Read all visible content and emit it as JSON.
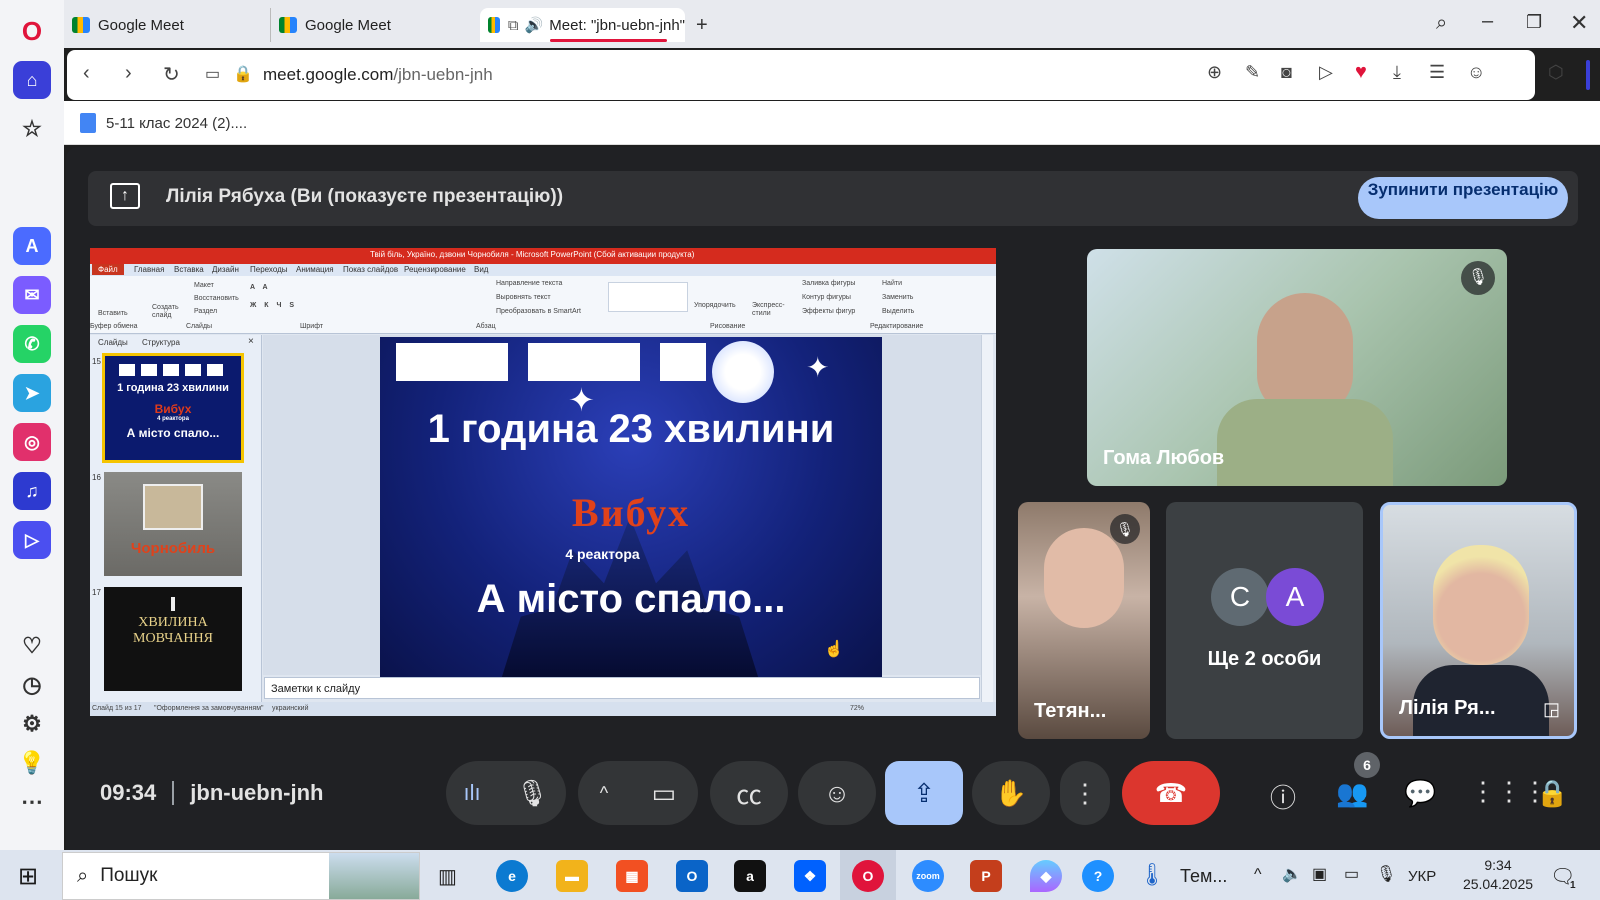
{
  "browser": {
    "tabs": [
      {
        "label": "Google Meet"
      },
      {
        "label": "Google Meet"
      },
      {
        "label": "Meet: \"jbn-uebn-jnh\""
      }
    ],
    "url_domain": "meet.google.com",
    "url_path": "/jbn-uebn-jnh",
    "bookmark": "5-11 клас 2024 (2)....",
    "accent": "#e0143b"
  },
  "meet": {
    "presenter_text": "Лілія Рябуха (Ви (показуєте презентацію))",
    "stop_button": "Зупинити презентацію",
    "time": "09:34",
    "meeting_code": "jbn-uebn-jnh",
    "participants_count": "6",
    "participants": [
      {
        "name": "Гома Любов",
        "muted": true
      },
      {
        "name": "Тетян...",
        "muted": true
      },
      {
        "initials": [
          "C",
          "A"
        ],
        "label": "Ще 2 особи"
      },
      {
        "name": "Лілія Ря..."
      }
    ]
  },
  "ppt": {
    "title": "Твій біль, Україно, дзвони Чорнобиля - Microsoft PowerPoint (Сбой активации продукта)",
    "ribbon_tabs": [
      "Файл",
      "Главная",
      "Вставка",
      "Дизайн",
      "Переходы",
      "Анимация",
      "Показ слайдов",
      "Рецензирование",
      "Вид"
    ],
    "groups": [
      "Буфер обмена",
      "Слайды",
      "Шрифт",
      "Абзац",
      "Рисование",
      "Редактирование"
    ],
    "cmd": {
      "paste": "Вставить",
      "new_slide": "Создать слайд",
      "layout": "Макет",
      "restore": "Восстановить",
      "section": "Раздел",
      "text_dir": "Направление текста",
      "align_text": "Выровнять текст",
      "smartart": "Преобразовать в SmartArt",
      "arrange": "Упорядочить",
      "quick_styles": "Экспресс-стили",
      "fill": "Заливка фигуры",
      "outline": "Контур фигуры",
      "effects": "Эффекты фигур",
      "find": "Найти",
      "replace": "Заменить",
      "select": "Выделить"
    },
    "panel_tabs": [
      "Слайды",
      "Структура"
    ],
    "thumbs": [
      {
        "num": "15",
        "lines": [
          "1 година 23 хвилини",
          "Вибух",
          "4 реактора",
          "А місто спало..."
        ]
      },
      {
        "num": "16",
        "lines": [
          "Чорнобиль"
        ]
      },
      {
        "num": "17",
        "lines": [
          "ХВИЛИНА",
          "МОВЧАННЯ"
        ]
      }
    ],
    "slide": {
      "line1": "1 година 23 хвилини",
      "line2": "Вибух",
      "line3": "4 реактора",
      "line4": "А місто спало..."
    },
    "notes": "Заметки к слайду",
    "status": {
      "slide": "Слайд 15 из 17",
      "theme": "\"Оформлення за замовчуванням\"",
      "lang": "украинский",
      "zoom": "72%"
    }
  },
  "taskbar": {
    "search": "Пошук",
    "temp_label": "Тем...",
    "lang": "УКР",
    "time": "9:34",
    "date": "25.04.2025",
    "notif": "1"
  }
}
